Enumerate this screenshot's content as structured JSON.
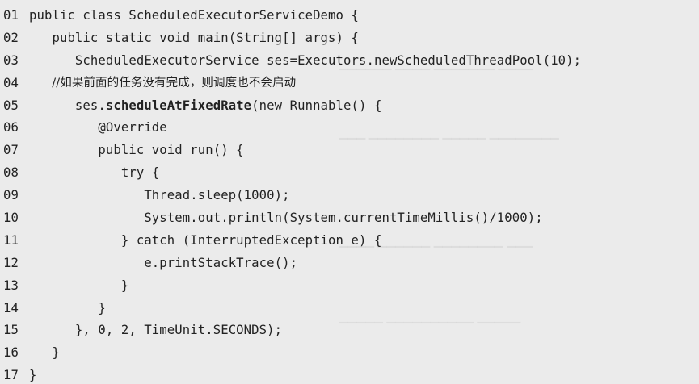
{
  "lines": [
    {
      "num": "01",
      "text": "public class ScheduledExecutorServiceDemo {"
    },
    {
      "num": "02",
      "text": "   public static void main(String[] args) {"
    },
    {
      "num": "03",
      "text": "      ScheduledExecutorService ses=Executors.newScheduledThreadPool(10);"
    },
    {
      "num": "04",
      "text": "      //如果前面的任务没有完成，则调度也不会启动"
    },
    {
      "num": "05",
      "pre": "      ses.",
      "bold": "scheduleAtFixedRate",
      "post": "(new Runnable() {"
    },
    {
      "num": "06",
      "text": "         @Override"
    },
    {
      "num": "07",
      "text": "         public void run() {"
    },
    {
      "num": "08",
      "text": "            try {"
    },
    {
      "num": "09",
      "text": "               Thread.sleep(1000);"
    },
    {
      "num": "10",
      "text": "               System.out.println(System.currentTimeMillis()/1000);"
    },
    {
      "num": "11",
      "text": "            } catch (InterruptedException e) {"
    },
    {
      "num": "12",
      "text": "               e.printStackTrace();"
    },
    {
      "num": "13",
      "text": "            }"
    },
    {
      "num": "14",
      "text": "         }"
    },
    {
      "num": "15",
      "text": "      }, 0, 2, TimeUnit.SECONDS);"
    },
    {
      "num": "16",
      "text": "   }"
    },
    {
      "num": "17",
      "text": "}"
    }
  ]
}
